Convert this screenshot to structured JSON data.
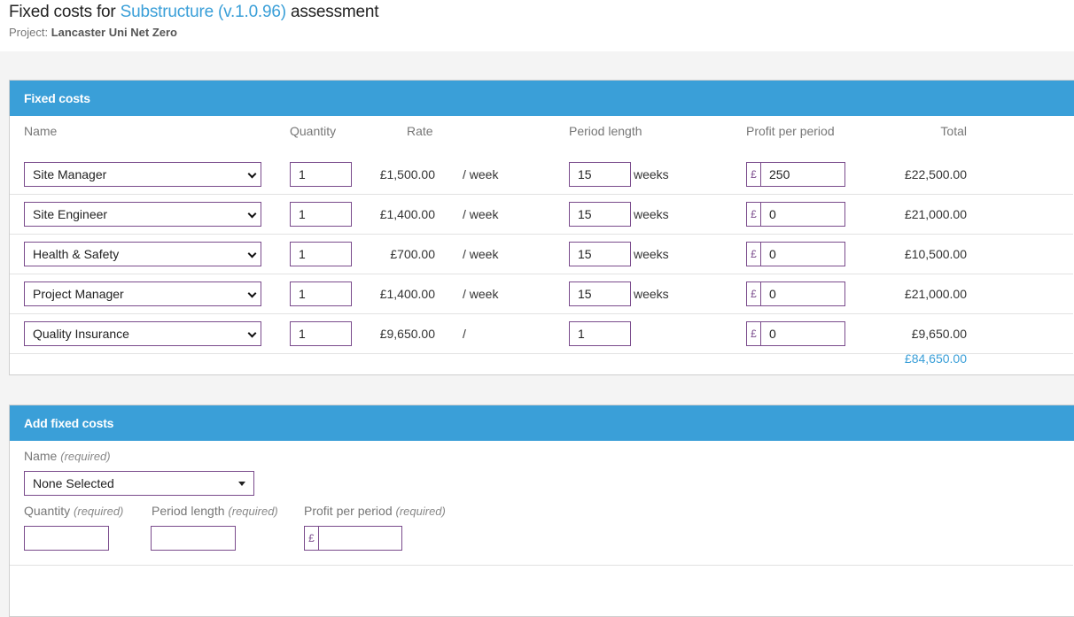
{
  "page": {
    "title_prefix": "Fixed costs for ",
    "title_link": "Substructure (v.1.0.96)",
    "title_suffix": " assessment",
    "project_label": "Project: ",
    "project_name": "Lancaster Uni Net Zero"
  },
  "colors": {
    "accent": "#3a9fd8",
    "input_border": "#7a4b8c",
    "link": "#3a9fd8"
  },
  "fixed_costs": {
    "heading": "Fixed costs",
    "columns": {
      "name": "Name",
      "quantity": "Quantity",
      "rate": "Rate",
      "period_length": "Period length",
      "profit_per_period": "Profit per period",
      "total": "Total"
    },
    "currency_symbol": "£",
    "rows": [
      {
        "name": "Site Manager",
        "quantity": "1",
        "rate": "£1,500.00",
        "unit": "/ week",
        "period": "15",
        "period_unit": "weeks",
        "profit": "250",
        "total": "£22,500.00"
      },
      {
        "name": "Site Engineer",
        "quantity": "1",
        "rate": "£1,400.00",
        "unit": "/ week",
        "period": "15",
        "period_unit": "weeks",
        "profit": "0",
        "total": "£21,000.00"
      },
      {
        "name": "Health & Safety",
        "quantity": "1",
        "rate": "£700.00",
        "unit": "/ week",
        "period": "15",
        "period_unit": "weeks",
        "profit": "0",
        "total": "£10,500.00"
      },
      {
        "name": "Project Manager",
        "quantity": "1",
        "rate": "£1,400.00",
        "unit": "/ week",
        "period": "15",
        "period_unit": "weeks",
        "profit": "0",
        "total": "£21,000.00"
      },
      {
        "name": "Quality Insurance",
        "quantity": "1",
        "rate": "£9,650.00",
        "unit": "/",
        "period": "1",
        "period_unit": "",
        "profit": "0",
        "total": "£9,650.00"
      }
    ],
    "grand_total": "£84,650.00"
  },
  "add_fixed_costs": {
    "heading": "Add fixed costs",
    "name_label": "Name",
    "required_note": "(required)",
    "name_selected": "None Selected",
    "quantity_label": "Quantity",
    "period_label": "Period length",
    "profit_label": "Profit per period",
    "currency_symbol": "£",
    "quantity_value": "",
    "period_value": "",
    "profit_value": ""
  }
}
